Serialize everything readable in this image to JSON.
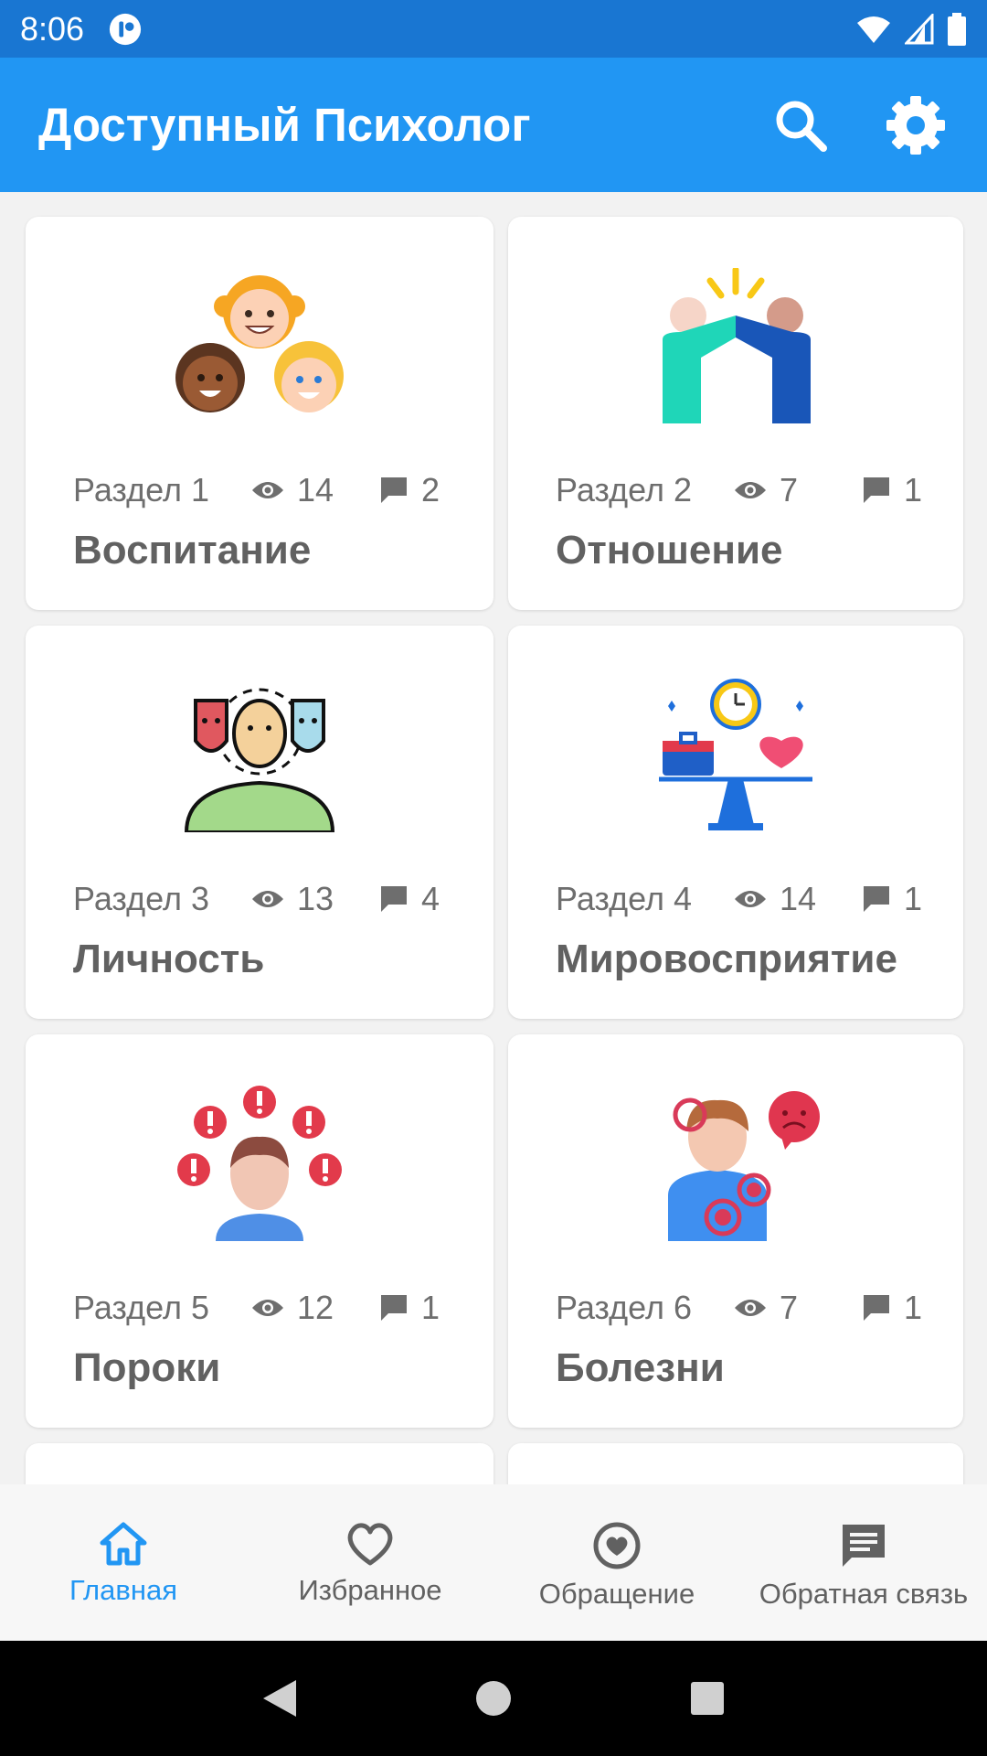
{
  "status_bar": {
    "time": "8:06"
  },
  "app_bar": {
    "title": "Доступный Психолог",
    "search_icon": "search-icon",
    "settings_icon": "gear-icon"
  },
  "colors": {
    "status_bar": "#1976d2",
    "app_bar": "#2196f3",
    "active_nav": "#2196f3",
    "text_muted": "#6e6e6e"
  },
  "cards": [
    {
      "section": "Раздел 1",
      "views": "14",
      "comments": "2",
      "title": "Воспитание",
      "illustration": "children-faces"
    },
    {
      "section": "Раздел 2",
      "views": "7",
      "comments": "1",
      "title": "Отношение",
      "illustration": "high-five"
    },
    {
      "section": "Раздел 3",
      "views": "13",
      "comments": "4",
      "title": "Личность",
      "illustration": "person-masks"
    },
    {
      "section": "Раздел 4",
      "views": "14",
      "comments": "1",
      "title": "Мировосприятие",
      "illustration": "balance-scale"
    },
    {
      "section": "Раздел 5",
      "views": "12",
      "comments": "1",
      "title": "Пороки",
      "illustration": "person-warnings"
    },
    {
      "section": "Раздел 6",
      "views": "7",
      "comments": "1",
      "title": "Болезни",
      "illustration": "person-pain"
    }
  ],
  "bottom_nav": [
    {
      "label": "Главная",
      "icon": "home-icon",
      "active": true
    },
    {
      "label": "Избранное",
      "icon": "heart-outline-icon",
      "active": false
    },
    {
      "label": "Обращение",
      "icon": "heart-circle-icon",
      "active": false
    },
    {
      "label": "Обратная связь",
      "icon": "feedback-icon",
      "active": false
    }
  ]
}
